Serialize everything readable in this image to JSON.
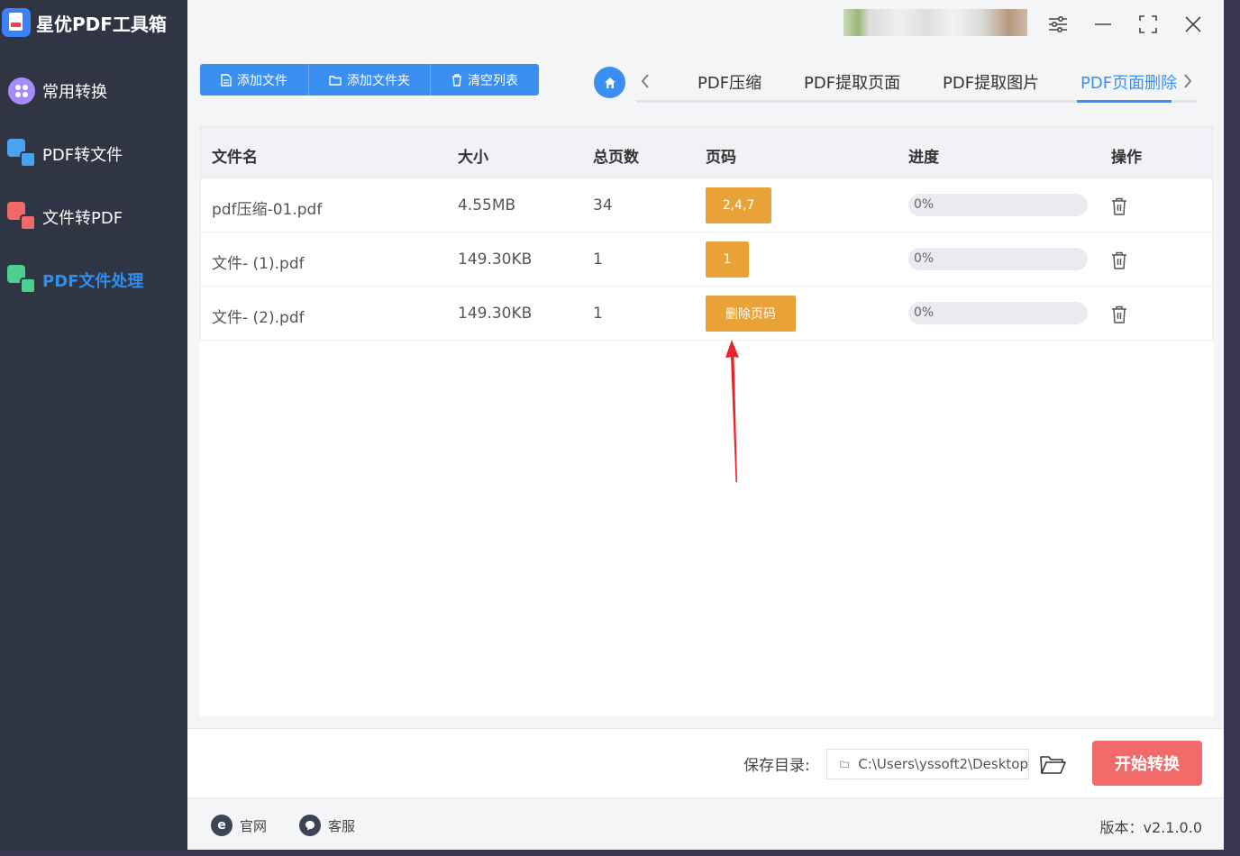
{
  "app": {
    "name": "星优PDF工具箱"
  },
  "sidebar": {
    "items": [
      {
        "label": "常用转换",
        "icon": "grid-icon"
      },
      {
        "label": "PDF转文件",
        "icon": "pdf-to-file-icon"
      },
      {
        "label": "文件转PDF",
        "icon": "file-to-pdf-icon"
      },
      {
        "label": "PDF文件处理",
        "icon": "pdf-process-icon",
        "active": true
      }
    ]
  },
  "toolbar": {
    "add_file": "添加文件",
    "add_folder": "添加文件夹",
    "clear_list": "清空列表"
  },
  "tabs": {
    "items": [
      {
        "label": "PDF压缩"
      },
      {
        "label": "PDF提取页面"
      },
      {
        "label": "PDF提取图片"
      },
      {
        "label": "PDF页面删除",
        "active": true
      }
    ]
  },
  "table": {
    "headers": {
      "name": "文件名",
      "size": "大小",
      "pages": "总页数",
      "page_code": "页码",
      "progress": "进度",
      "action": "操作"
    },
    "rows": [
      {
        "name": "pdf压缩-01.pdf",
        "size": "4.55MB",
        "pages": "34",
        "page_code": "2,4,7",
        "progress": 0,
        "progress_text": "0%"
      },
      {
        "name": "文件- (1).pdf",
        "size": "149.30KB",
        "pages": "1",
        "page_code": "1",
        "progress": 0,
        "progress_text": "0%"
      },
      {
        "name": "文件- (2).pdf",
        "size": "149.30KB",
        "pages": "1",
        "page_code": "删除页码",
        "progress": 0,
        "progress_text": "0%"
      }
    ]
  },
  "bottom": {
    "save_label": "保存目录:",
    "save_path": "C:\\Users\\yssoft2\\Desktop",
    "start_button": "开始转换"
  },
  "footer": {
    "website": "官网",
    "support": "客服",
    "version": "版本：v2.1.0.0"
  },
  "colors": {
    "primary": "#3b8ff3",
    "sidebar_bg": "#2f3542",
    "page_button": "#e9a237",
    "start_button": "#f26b6b",
    "annotation_arrow": "#e8232a"
  }
}
